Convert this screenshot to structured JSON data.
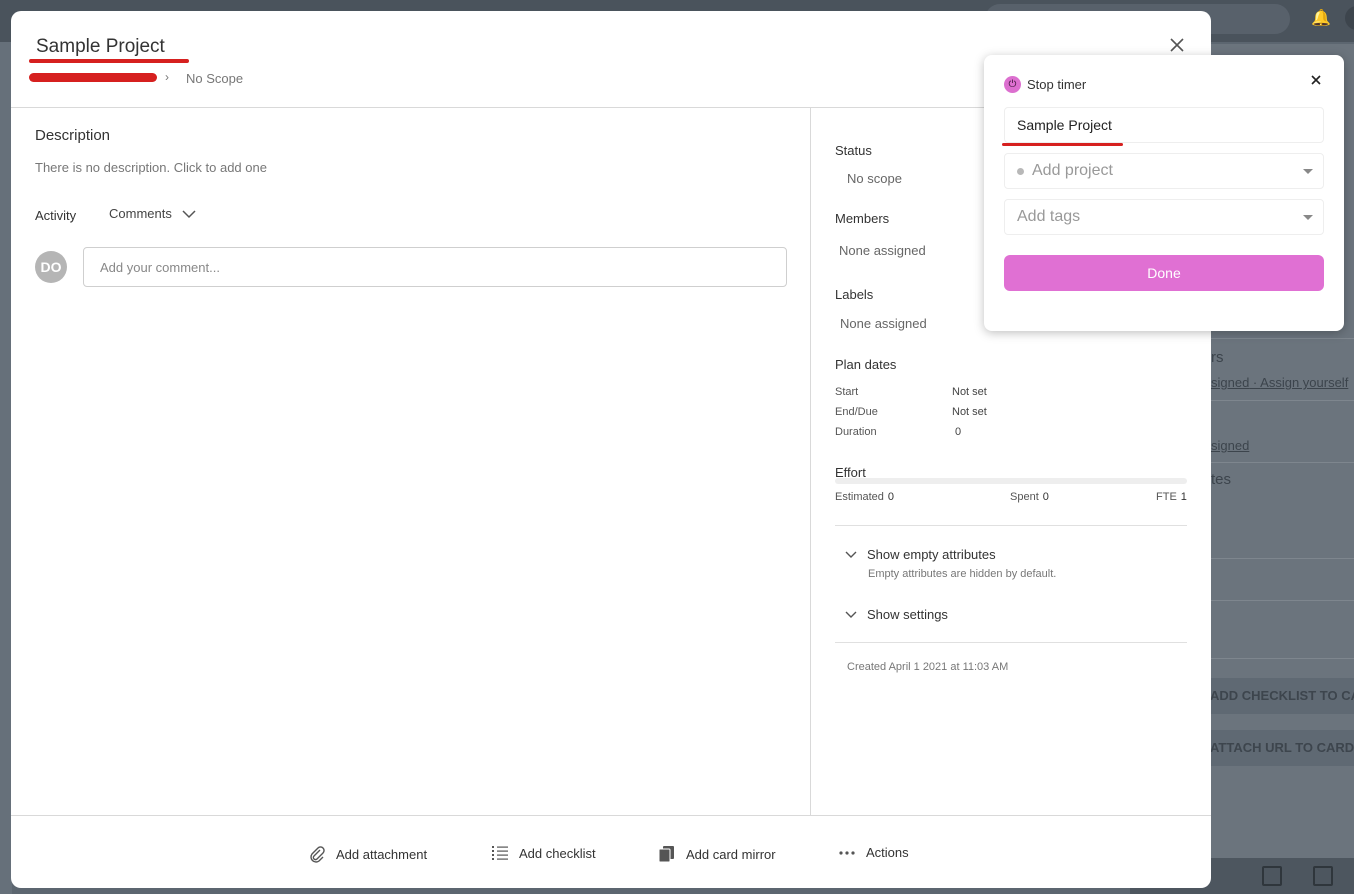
{
  "card": {
    "title": "Sample Project",
    "breadcrumb_scope": "No Scope"
  },
  "description": {
    "title": "Description",
    "empty_text": "There is no description. Click to add one"
  },
  "activity": {
    "label": "Activity",
    "filter": "Comments",
    "avatar_initials": "DO",
    "comment_placeholder": "Add your comment..."
  },
  "attributes": {
    "status_title": "Status",
    "status_value": "No scope",
    "members_title": "Members",
    "members_value": "None assigned",
    "labels_title": "Labels",
    "labels_value": "None assigned",
    "plan_dates_title": "Plan dates",
    "plan_dates": [
      {
        "key": "Start",
        "value": "Not set"
      },
      {
        "key": "End/Due",
        "value": "Not set"
      },
      {
        "key": "Duration",
        "value": "0"
      }
    ],
    "effort_title": "Effort",
    "effort": {
      "estimated_label": "Estimated",
      "estimated_value": "0",
      "spent_label": "Spent",
      "spent_value": "0",
      "fte_label": "FTE",
      "fte_value": "1",
      "progress": 0
    },
    "show_empty_label": "Show empty attributes",
    "show_empty_sub": "Empty attributes are hidden by default.",
    "show_settings_label": "Show settings",
    "created": "Created April 1 2021 at 11:03 AM"
  },
  "footer": {
    "add_attachment": "Add attachment",
    "add_checklist": "Add checklist",
    "add_card_mirror": "Add card mirror",
    "actions": "Actions"
  },
  "timer": {
    "title": "Stop timer",
    "description_value": "Sample Project",
    "project_placeholder": "Add project",
    "tags_placeholder": "Add tags",
    "done_label": "Done",
    "accent": "#e070d3"
  },
  "background": {
    "members_fragment": "rs",
    "assigned_link": "signed",
    "assign_yourself_link": "Assign yourself",
    "assigned_link_2": "signed",
    "dates_fragment": "tes",
    "add_checklist_btn": "ADD CHECKLIST TO CARD",
    "attach_url_btn": "ATTACH URL TO CARD"
  },
  "colors": {
    "redaction": "#d6201f",
    "overlay": "#5c6670"
  }
}
